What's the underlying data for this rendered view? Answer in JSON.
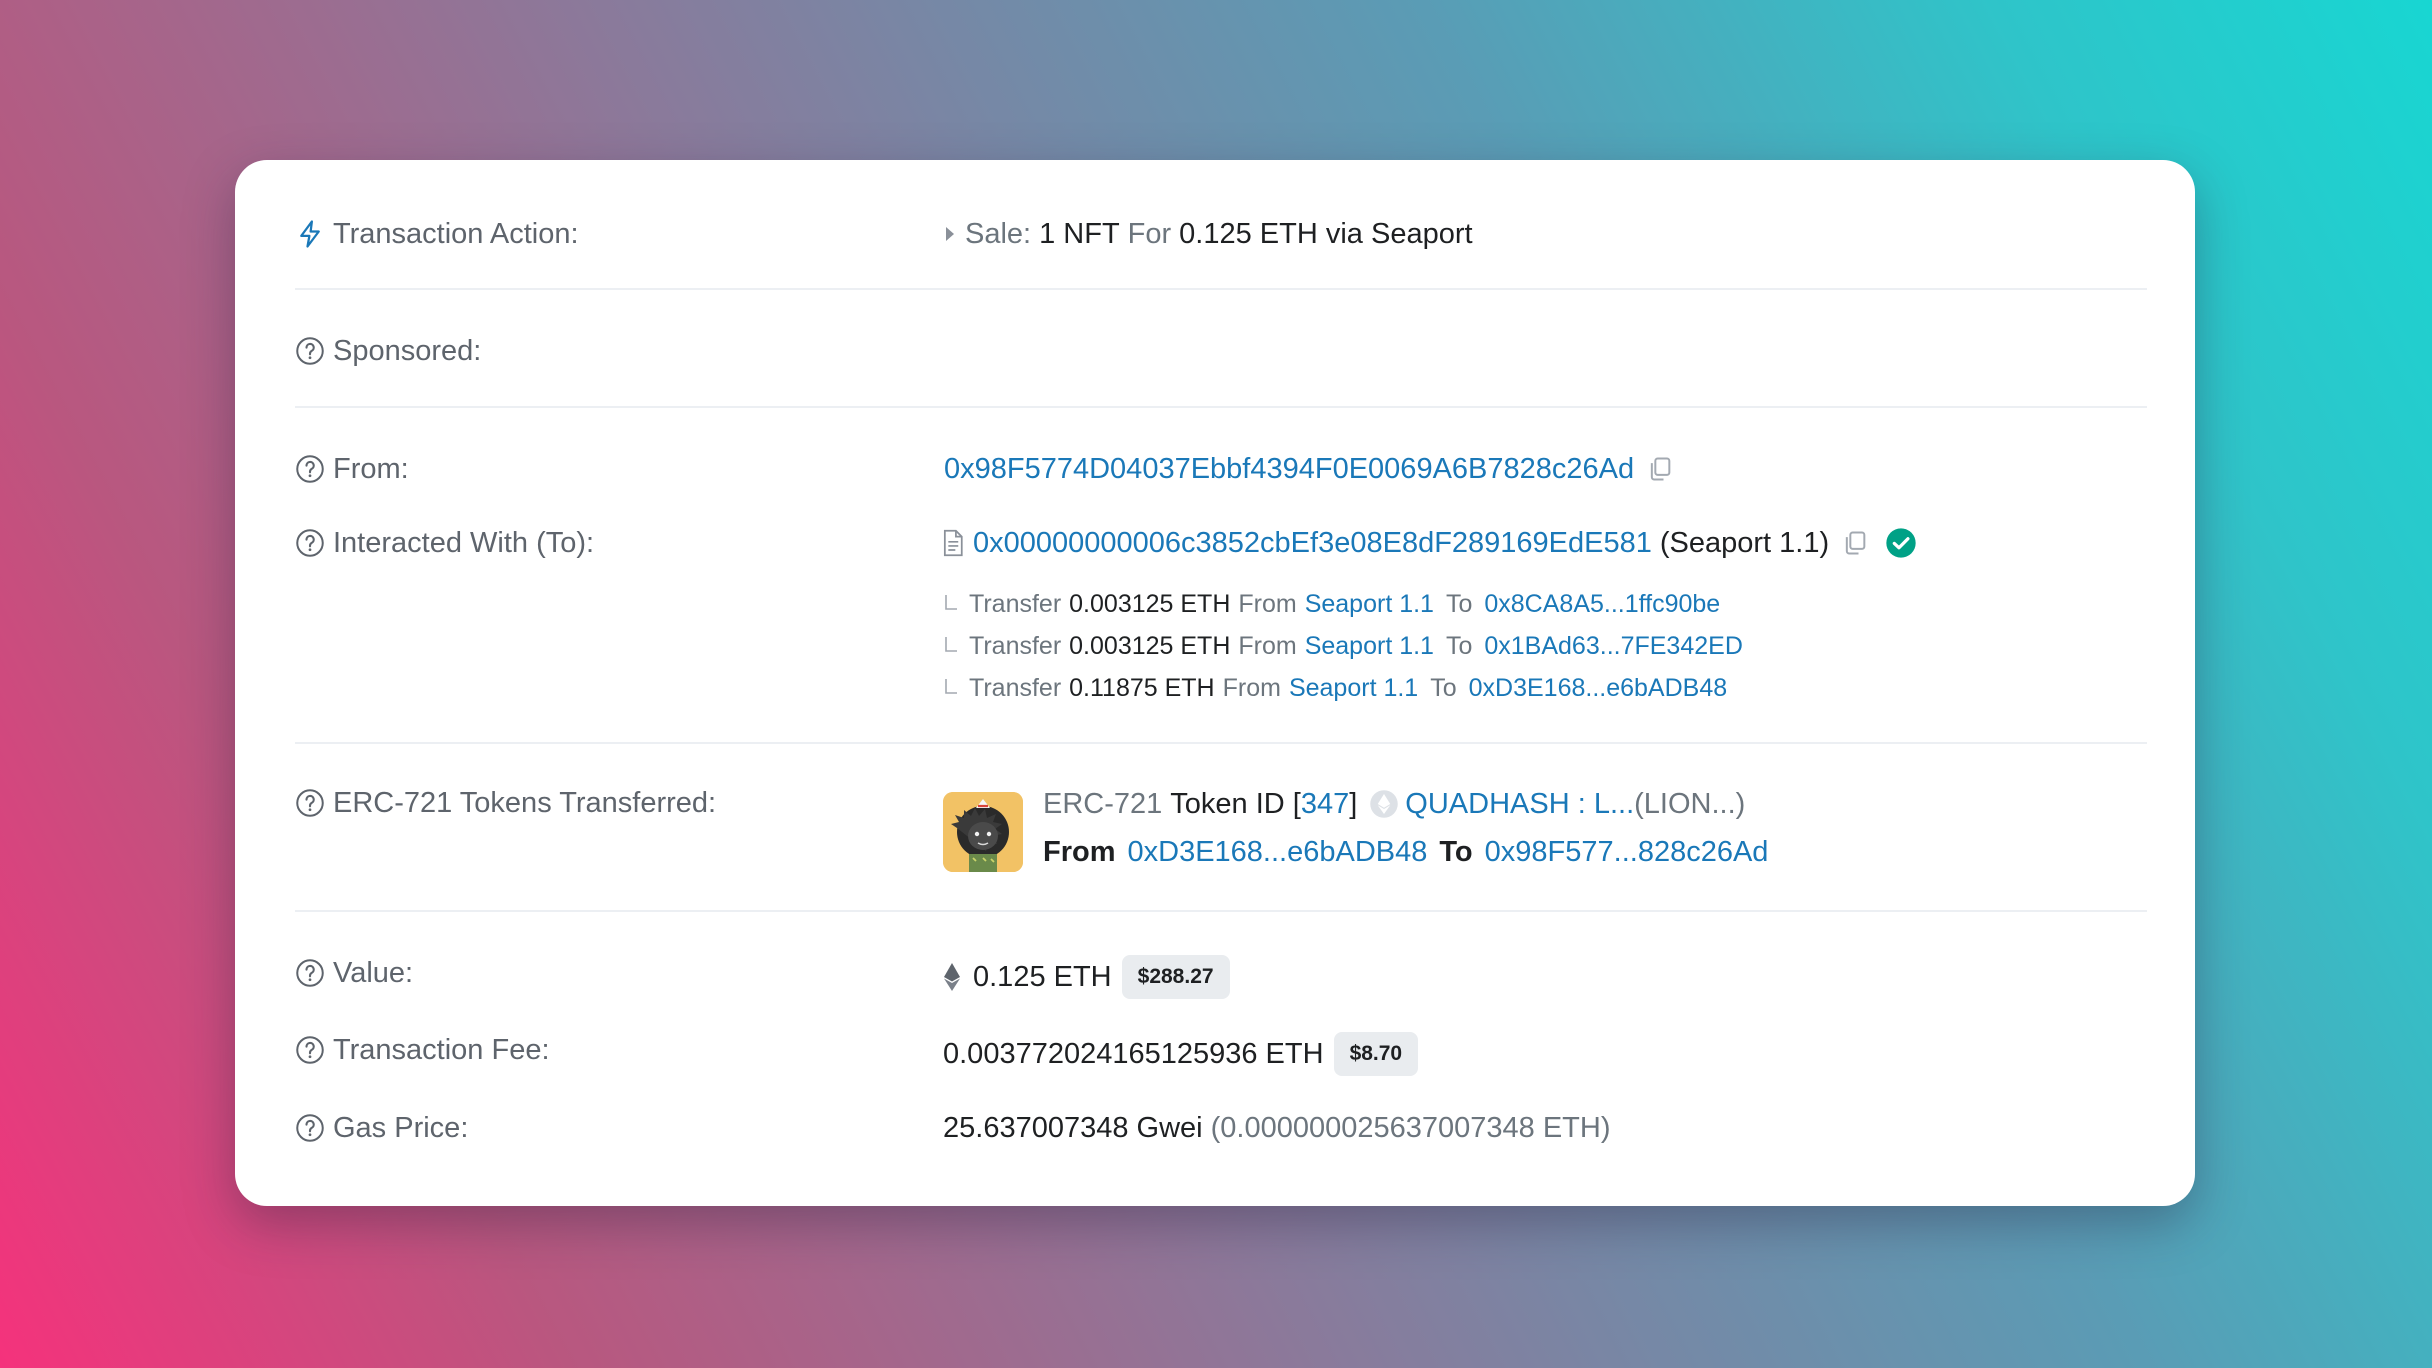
{
  "transaction_action": {
    "label": "Transaction Action:",
    "sale_label": "Sale:",
    "amount": "1 NFT",
    "for_label": "For",
    "price_text": "0.125 ETH via Seaport"
  },
  "sponsored": {
    "label": "Sponsored:"
  },
  "from": {
    "label": "From:",
    "address": "0x98F5774D04037Ebbf4394F0E0069A6B7828c26Ad"
  },
  "interacted_with": {
    "label": "Interacted With (To):",
    "address": "0x00000000006c3852cbEf3e08E8dF289169EdE581",
    "contract_name": "(Seaport 1.1)",
    "transfers": [
      {
        "word": "Transfer",
        "amount": "0.003125 ETH",
        "from_word": "From",
        "from": "Seaport 1.1",
        "to_word": "To",
        "to": "0x8CA8A5...1ffc90be"
      },
      {
        "word": "Transfer",
        "amount": "0.003125 ETH",
        "from_word": "From",
        "from": "Seaport 1.1",
        "to_word": "To",
        "to": "0x1BAd63...7FE342ED"
      },
      {
        "word": "Transfer",
        "amount": "0.11875 ETH",
        "from_word": "From",
        "from": "Seaport 1.1",
        "to_word": "To",
        "to": "0xD3E168...e6bADB48"
      }
    ]
  },
  "erc721": {
    "label": "ERC-721 Tokens Transferred:",
    "standard": "ERC-721",
    "token_id_label": "Token ID [",
    "token_id": "347",
    "token_id_close": "]",
    "collection": "QUADHASH : L...",
    "collection_symbol": "(LION...)",
    "from_word": "From",
    "from": "0xD3E168...e6bADB48",
    "to_word": "To",
    "to": "0x98F577...828c26Ad"
  },
  "value": {
    "label": "Value:",
    "amount": "0.125 ETH",
    "usd": "$288.27"
  },
  "fee": {
    "label": "Transaction Fee:",
    "amount": "0.003772024165125936 ETH",
    "usd": "$8.70"
  },
  "gas": {
    "label": "Gas Price:",
    "amount": "25.637007348 Gwei",
    "eth": "(0.000000025637007348 ETH)"
  },
  "colors": {
    "link": "#1a78b8",
    "label": "#5e646c",
    "verified": "#00a186",
    "pill_bg": "#e9ecef"
  },
  "icons": [
    "bolt-icon",
    "question-circle-icon",
    "copy-icon",
    "document-icon",
    "verified-check-icon",
    "caret-right-icon",
    "ethereum-icon",
    "nft-collection-icon"
  ]
}
